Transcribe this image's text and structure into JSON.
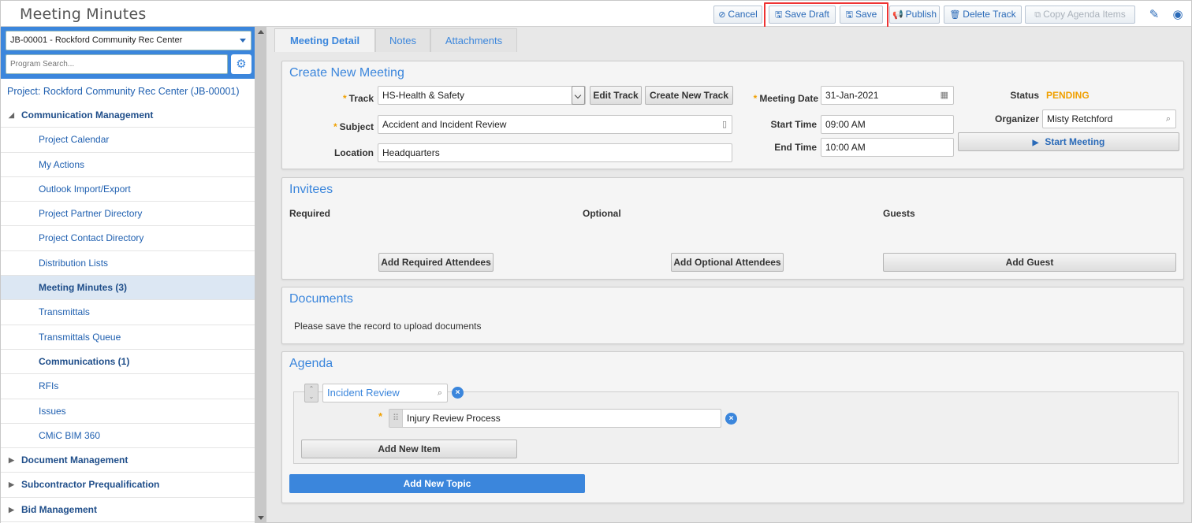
{
  "app": {
    "title": "Meeting Minutes"
  },
  "toolbar": {
    "cancel": "Cancel",
    "save_draft": "Save Draft",
    "save": "Save",
    "publish": "Publish",
    "delete_track": "Delete Track",
    "copy_agenda": "Copy Agenda Items"
  },
  "sidebar": {
    "project_select": "JB-00001 - Rockford Community Rec Center",
    "search_placeholder": "Program Search...",
    "project_link": "Project: Rockford Community Rec Center (JB-00001)",
    "items": [
      {
        "label": "Communication Management"
      },
      {
        "label": "Project Calendar"
      },
      {
        "label": "My Actions"
      },
      {
        "label": "Outlook Import/Export"
      },
      {
        "label": "Project Partner Directory"
      },
      {
        "label": "Project Contact Directory"
      },
      {
        "label": "Distribution Lists"
      },
      {
        "label": "Meeting Minutes (3)"
      },
      {
        "label": "Transmittals"
      },
      {
        "label": "Transmittals Queue"
      },
      {
        "label": "Communications (1)"
      },
      {
        "label": "RFIs"
      },
      {
        "label": "Issues"
      },
      {
        "label": "CMiC BIM 360"
      },
      {
        "label": "Document Management"
      },
      {
        "label": "Subcontractor Prequalification"
      },
      {
        "label": "Bid Management"
      }
    ]
  },
  "tabs": [
    {
      "label": "Meeting Detail"
    },
    {
      "label": "Notes"
    },
    {
      "label": "Attachments"
    }
  ],
  "create": {
    "title": "Create New Meeting",
    "track_label": "Track",
    "track_value": "HS-Health & Safety",
    "edit_track": "Edit Track",
    "create_track": "Create New Track",
    "subject_label": "Subject",
    "subject_value": "Accident and Incident Review",
    "location_label": "Location",
    "location_value": "Headquarters",
    "meeting_date_label": "Meeting Date",
    "meeting_date_value": "31-Jan-2021",
    "start_label": "Start Time",
    "start_value": "09:00 AM",
    "end_label": "End Time",
    "end_value": "10:00 AM",
    "status_label": "Status",
    "status_value": "PENDING",
    "organizer_label": "Organizer",
    "organizer_value": "Misty Retchford",
    "start_meeting": "Start Meeting"
  },
  "invitees": {
    "title": "Invitees",
    "required": "Required",
    "optional": "Optional",
    "guests": "Guests",
    "add_required": "Add Required Attendees",
    "add_optional": "Add Optional Attendees",
    "add_guest": "Add Guest"
  },
  "documents": {
    "title": "Documents",
    "message": "Please save the record to upload documents"
  },
  "agenda": {
    "title": "Agenda",
    "topic": "Incident Review",
    "item": "Injury Review Process",
    "add_item": "Add New Item",
    "add_topic": "Add New Topic"
  },
  "colors": {
    "accent": "#3b86dc",
    "status_pending": "#f0a000",
    "highlight": "#e33333"
  }
}
